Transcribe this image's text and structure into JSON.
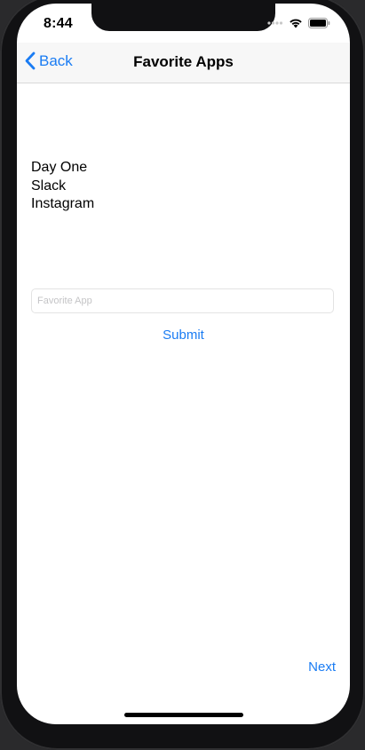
{
  "status_bar": {
    "time": "8:44",
    "icons": [
      "signal-dots-icon",
      "wifi-icon",
      "battery-icon"
    ]
  },
  "nav": {
    "back_label": "Back",
    "title": "Favorite Apps"
  },
  "apps": [
    "Day One",
    "Slack",
    "Instagram"
  ],
  "form": {
    "input_placeholder": "Favorite App",
    "input_value": "",
    "submit_label": "Submit"
  },
  "footer": {
    "next_label": "Next"
  },
  "colors": {
    "accent": "#1a7cf3",
    "nav_background": "#f7f7f7",
    "text": "#000000",
    "device_frame": "#111113"
  }
}
